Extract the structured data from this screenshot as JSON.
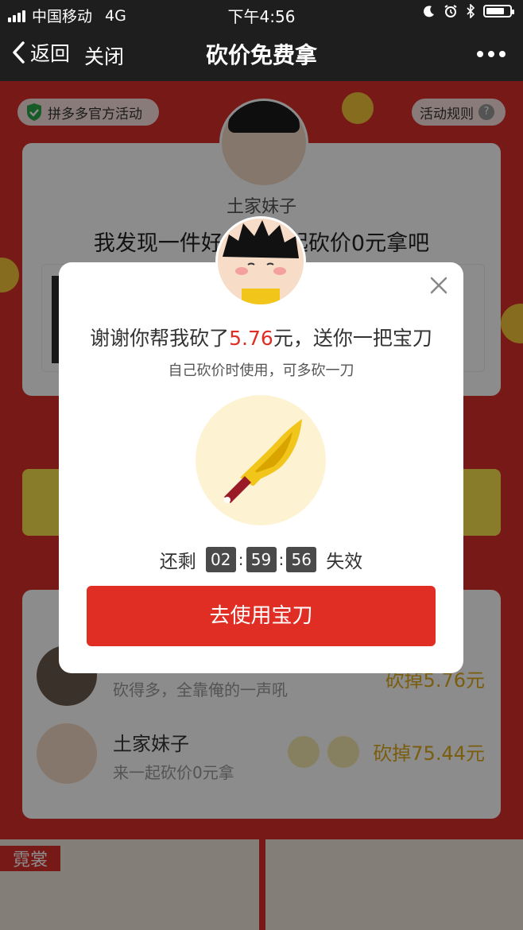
{
  "status": {
    "carrier": "中国移动",
    "network": "4G",
    "time": "下午4:56"
  },
  "nav": {
    "back": "返回",
    "close": "关闭",
    "title": "砍价免费拿"
  },
  "page": {
    "official_badge": "拼多多官方活动",
    "rules": "活动规则",
    "rules_help": "?",
    "inviter_name": "土家妹子",
    "invite_text": "我发现一件好货，一起砍价0元拿吧",
    "helpers": [
      {
        "message": "砍得多，全靠俺的一声吼",
        "amount": "砍掉5.76元"
      },
      {
        "name": "土家妹子",
        "message": "来一起砍价0元拿",
        "amount": "砍掉75.44元"
      }
    ],
    "promo_label": "霓裳"
  },
  "dialog": {
    "title_prefix": "谢谢你帮我砍了",
    "amount": "5.76",
    "title_suffix": "元，送你一把宝刀",
    "subtitle": "自己砍价时使用，可多砍一刀",
    "timer_prefix": "还剩",
    "hours": "02",
    "minutes": "59",
    "seconds": "56",
    "timer_suffix": "失效",
    "button": "去使用宝刀"
  },
  "colors": {
    "accent": "#e02e24",
    "page_red": "#d9302a",
    "gold": "#f3c21b"
  }
}
